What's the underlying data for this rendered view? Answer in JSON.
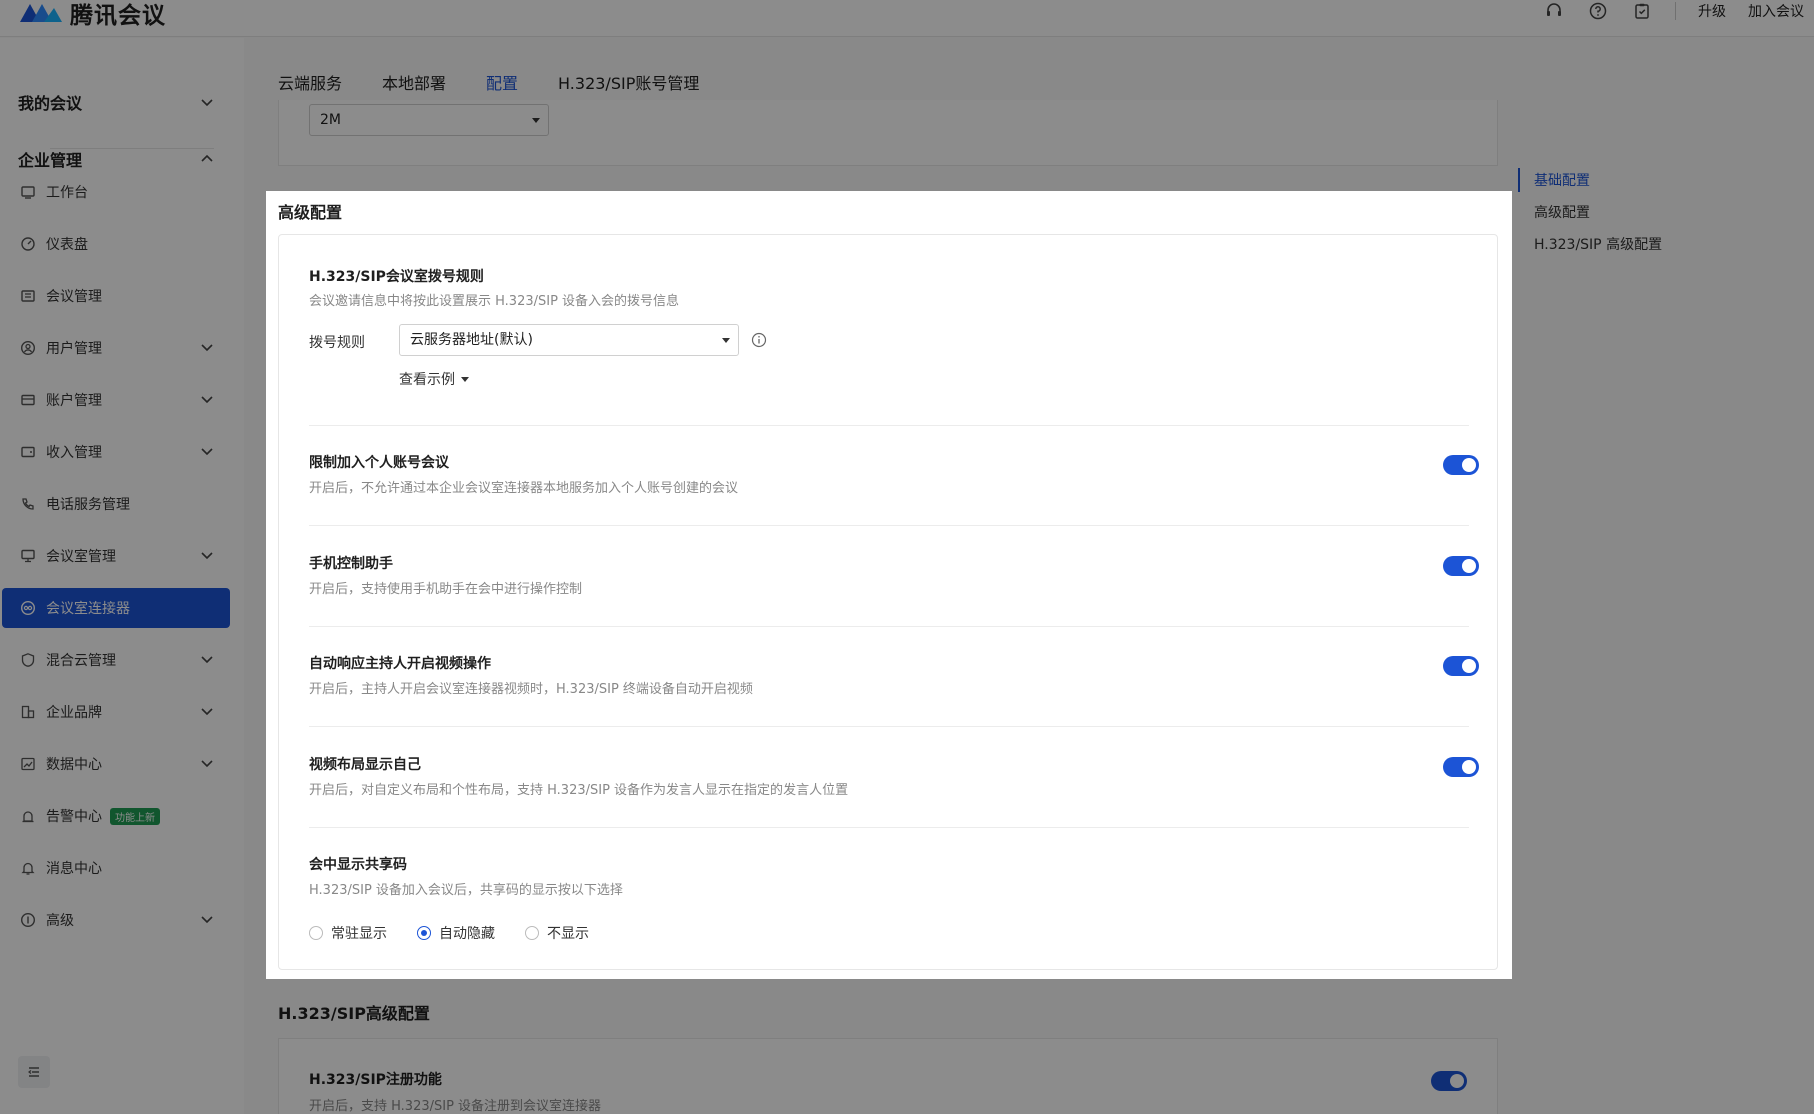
{
  "app": {
    "title": "腾讯会议"
  },
  "topbar": {
    "upgrade": "升级",
    "join": "加入会议"
  },
  "sidebar": {
    "my_meetings": "我的会议",
    "enterprise": "企业管理",
    "items": [
      {
        "label": "工作台"
      },
      {
        "label": "仪表盘"
      },
      {
        "label": "会议管理"
      },
      {
        "label": "用户管理"
      },
      {
        "label": "账户管理"
      },
      {
        "label": "收入管理"
      },
      {
        "label": "电话服务管理"
      },
      {
        "label": "会议室管理"
      },
      {
        "label": "会议室连接器"
      },
      {
        "label": "混合云管理"
      },
      {
        "label": "企业品牌"
      },
      {
        "label": "数据中心"
      },
      {
        "label": "告警中心",
        "badge": "功能上新"
      },
      {
        "label": "消息中心"
      },
      {
        "label": "高级"
      }
    ]
  },
  "tabs": [
    "云端服务",
    "本地部署",
    "配置",
    "H.323/SIP账号管理"
  ],
  "top_select_value": "2M",
  "right_nav": [
    "基础配置",
    "高级配置",
    "H.323/SIP 高级配置"
  ],
  "panel": {
    "title": "高级配置",
    "dial": {
      "title": "H.323/SIP会议室拨号规则",
      "desc": "会议邀请信息中将按此设置展示 H.323/SIP 设备入会的拨号信息",
      "label": "拨号规则",
      "value": "云服务器地址(默认)",
      "example": "查看示例"
    },
    "settings": [
      {
        "title": "限制加入个人账号会议",
        "desc": "开启后，不允许通过本企业会议室连接器本地服务加入个人账号创建的会议",
        "on": true
      },
      {
        "title": "手机控制助手",
        "desc": "开启后，支持使用手机助手在会中进行操作控制",
        "on": true
      },
      {
        "title": "自动响应主持人开启视频操作",
        "desc": "开启后，主持人开启会议室连接器视频时，H.323/SIP 终端设备自动开启视频",
        "on": true
      },
      {
        "title": "视频布局显示自己",
        "desc": "开启后，对自定义布局和个性布局，支持 H.323/SIP 设备作为发言人显示在指定的发言人位置",
        "on": true
      }
    ],
    "share_code": {
      "title": "会中显示共享码",
      "desc": "H.323/SIP 设备加入会议后，共享码的显示按以下选择",
      "options": [
        "常驻显示",
        "自动隐藏",
        "不显示"
      ],
      "selected": "自动隐藏"
    }
  },
  "bottom": {
    "section_title": "H.323/SIP高级配置",
    "title": "H.323/SIP注册功能",
    "desc": "开启后，支持 H.323/SIP 设备注册到会议室连接器"
  },
  "colors": {
    "accent": "#1c54d6",
    "badge": "#1f9d55"
  }
}
